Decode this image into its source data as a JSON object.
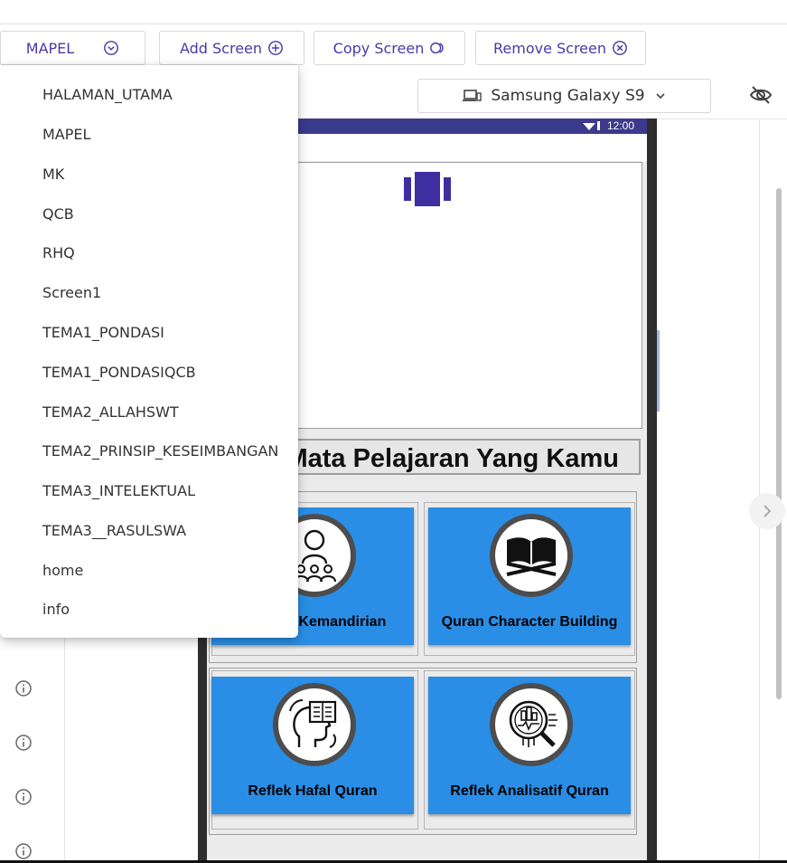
{
  "toolbar": {
    "screen_select": "MAPEL",
    "add_screen": "Add Screen",
    "copy_screen": "Copy Screen",
    "remove_screen": "Remove Screen"
  },
  "device": {
    "name": "Samsung Galaxy S9"
  },
  "phone": {
    "time": "12:00",
    "title": "Mata Pelajaran Yang Kamu",
    "cards": [
      {
        "label": "Leading Kemandirian",
        "icon": "teacher-icon"
      },
      {
        "label": "Quran Character Building",
        "icon": "quran-book-icon"
      },
      {
        "label": "Reflek Hafal Quran",
        "icon": "head-book-icon"
      },
      {
        "label": "Reflek Analisatif Quran",
        "icon": "magnifier-chart-icon"
      }
    ]
  },
  "screen_list": [
    "HALAMAN_UTAMA",
    "MAPEL",
    "MK",
    "QCB",
    "RHQ",
    "Screen1",
    "TEMA1_PONDASI",
    "TEMA1_PONDASIQCB",
    "TEMA2_ALLAHSWT",
    "TEMA2_PRINSIP_KESEIMBANGAN",
    "TEMA3_INTELEKTUAL",
    "TEMA3__RASULSWA",
    "home",
    "info"
  ],
  "colors": {
    "accent": "#4a3aa8",
    "card_blue": "#2a8ee6",
    "statusbar": "#3c3a8c"
  }
}
